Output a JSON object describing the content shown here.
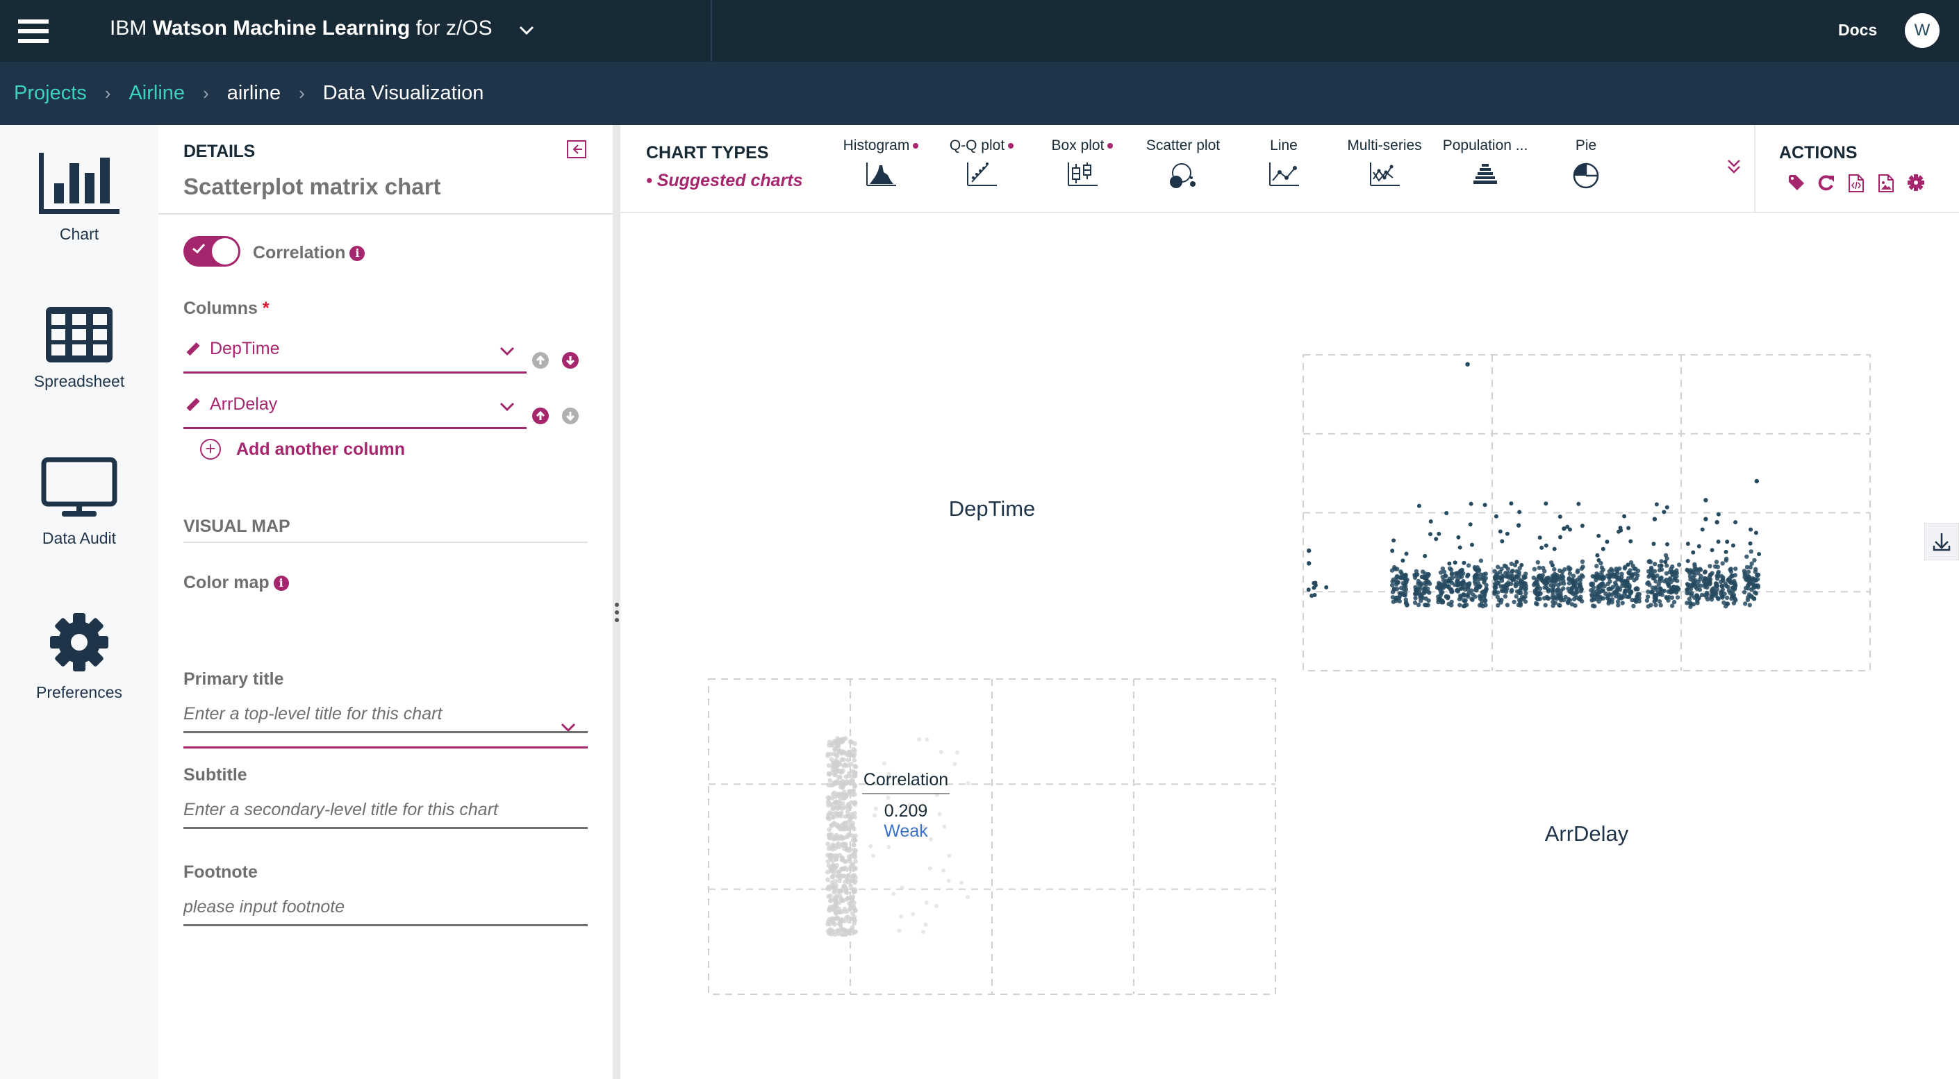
{
  "topbar": {
    "menu_icon": "hamburger-icon",
    "title_prefix": "IBM",
    "title_bold": "Watson Machine Learning",
    "title_suffix": "for z/OS",
    "docs_label": "Docs",
    "avatar_initial": "W"
  },
  "breadcrumb": [
    {
      "label": "Projects",
      "link": true
    },
    {
      "label": "Airline",
      "link": true
    },
    {
      "label": "airline",
      "link": false
    },
    {
      "label": "Data Visualization",
      "link": false
    }
  ],
  "leftnav": [
    {
      "label": "Chart",
      "icon": "bar-chart-icon"
    },
    {
      "label": "Spreadsheet",
      "icon": "table-grid-icon"
    },
    {
      "label": "Data Audit",
      "icon": "monitor-icon"
    },
    {
      "label": "Preferences",
      "icon": "gear-icon"
    }
  ],
  "details": {
    "section_title": "DETAILS",
    "chart_name": "Scatterplot matrix chart",
    "correlation_toggle": {
      "label": "Correlation",
      "on": true
    },
    "columns_label": "Columns",
    "required_mark": "*",
    "columns": [
      {
        "value": "DepTime",
        "move_up_enabled": false,
        "move_down_enabled": true
      },
      {
        "value": "ArrDelay",
        "move_up_enabled": true,
        "move_down_enabled": false
      }
    ],
    "add_column_label": "Add another column",
    "visual_map_title": "VISUAL MAP",
    "color_map_label": "Color map",
    "color_map_value": "",
    "primary_title_label": "Primary title",
    "primary_title_placeholder": "Enter a top-level title for this chart",
    "subtitle_label": "Subtitle",
    "subtitle_placeholder": "Enter a secondary-level title for this chart",
    "footnote_label": "Footnote",
    "footnote_placeholder": "please input footnote"
  },
  "toolbar": {
    "chart_types_title": "CHART TYPES",
    "suggested_label": "• Suggested charts",
    "chart_types": [
      {
        "label": "Histogram",
        "suggested": true,
        "icon": "histogram-icon"
      },
      {
        "label": "Q-Q plot",
        "suggested": true,
        "icon": "qq-plot-icon"
      },
      {
        "label": "Box plot",
        "suggested": true,
        "icon": "box-plot-icon"
      },
      {
        "label": "Scatter plot",
        "suggested": false,
        "icon": "scatter-plot-icon"
      },
      {
        "label": "Line",
        "suggested": false,
        "icon": "line-chart-icon"
      },
      {
        "label": "Multi-series",
        "suggested": false,
        "icon": "multi-series-icon"
      },
      {
        "label": "Population ...",
        "suggested": false,
        "icon": "population-pyramid-icon"
      },
      {
        "label": "Pie",
        "suggested": false,
        "icon": "pie-chart-icon"
      }
    ],
    "more_icon": "double-chevron-down-icon",
    "actions_title": "ACTIONS",
    "actions": [
      "tag-icon",
      "refresh-icon",
      "code-file-icon",
      "image-file-icon",
      "settings-icon"
    ]
  },
  "colors": {
    "accent": "#a6266e",
    "topbar": "#172a36",
    "breadcrumb_bar": "#1f3449",
    "link": "#3dd1bf",
    "point": "#264a60",
    "point_faded": "#d0d0d0",
    "weak": "#3b73c6"
  },
  "chart_data": {
    "type": "scatter",
    "title": "Scatterplot matrix",
    "variables": [
      "DepTime",
      "ArrDelay"
    ],
    "diagonal_labels": [
      "DepTime",
      "ArrDelay"
    ],
    "correlation": {
      "label": "Correlation",
      "value": "0.209",
      "strength": "Weak"
    },
    "upper_cell": {
      "x": "ArrDelay",
      "y": "DepTime",
      "description": "Dense vertical bands of points at regular DepTime intervals across the x range, clustered near the lower-middle horizontal gridline with sparse outliers above",
      "grid_cols": 3,
      "grid_rows": 4,
      "bands_x_fraction": [
        0.17,
        0.21,
        0.25,
        0.28,
        0.31,
        0.35,
        0.38,
        0.42,
        0.45,
        0.48,
        0.52,
        0.55,
        0.58,
        0.62,
        0.65,
        0.69,
        0.72,
        0.75,
        0.79
      ],
      "band_center_y_fraction": 0.75,
      "outliers": [
        [
          0.29,
          0.03
        ],
        [
          0.8,
          0.4
        ],
        [
          0.71,
          0.46
        ],
        [
          0.71,
          0.52
        ],
        [
          0.62,
          0.52
        ],
        [
          0.38,
          0.54
        ],
        [
          0.46,
          0.55
        ],
        [
          0.73,
          0.53
        ],
        [
          0.01,
          0.62
        ],
        [
          0.01,
          0.66
        ]
      ]
    },
    "lower_cell": {
      "x": "DepTime",
      "y": "ArrDelay",
      "description": "Faded vertical stack of points concentrated at the left portion (just left of first vertical gridline)",
      "grid_cols": 4,
      "grid_rows": 3,
      "stack_x_fraction": 0.24,
      "stack_y_range_fraction": [
        0.2,
        0.8
      ]
    }
  }
}
